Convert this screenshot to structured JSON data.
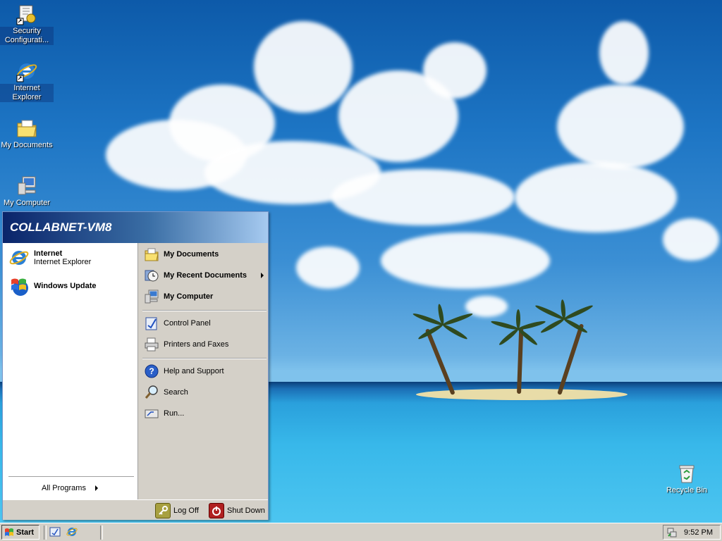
{
  "desktop": {
    "icons": [
      {
        "label": "Security Configurati...",
        "icon": "security-config-icon"
      },
      {
        "label": "Internet Explorer",
        "icon": "internet-explorer-icon"
      },
      {
        "label": "My Documents",
        "icon": "folder-documents-icon"
      },
      {
        "label": "My Computer",
        "icon": "computer-icon"
      },
      {
        "label": "Recycle Bin",
        "icon": "recycle-bin-icon"
      }
    ]
  },
  "start_menu": {
    "user": "COLLABNET-VM8",
    "pinned": [
      {
        "title": "Internet",
        "subtitle": "Internet Explorer",
        "icon": "internet-explorer-icon"
      },
      {
        "title": "Windows Update",
        "subtitle": "",
        "icon": "windows-update-icon"
      }
    ],
    "all_programs": "All Programs",
    "right_items": [
      {
        "label": "My Documents",
        "icon": "folder-documents-icon",
        "bold": true
      },
      {
        "label": "My Recent Documents",
        "icon": "recent-documents-icon",
        "bold": true,
        "submenu": true
      },
      {
        "label": "My Computer",
        "icon": "computer-icon",
        "bold": true
      },
      {
        "label": "Control Panel",
        "icon": "control-panel-icon"
      },
      {
        "label": "Printers and Faxes",
        "icon": "printer-icon"
      },
      {
        "label": "Help and Support",
        "icon": "help-icon"
      },
      {
        "label": "Search",
        "icon": "search-icon"
      },
      {
        "label": "Run...",
        "icon": "run-icon"
      }
    ],
    "log_off": "Log Off",
    "shut_down": "Shut Down"
  },
  "taskbar": {
    "start_label": "Start",
    "quick_launch": [
      "show-desktop-icon",
      "internet-explorer-icon"
    ],
    "clock": "9:52 PM"
  },
  "colors": {
    "header_start": "#0a246a",
    "header_end": "#a6caf0",
    "menu_bg": "#d4d0c8",
    "sky": "#1d75c4",
    "sea": "#38b8ea"
  }
}
